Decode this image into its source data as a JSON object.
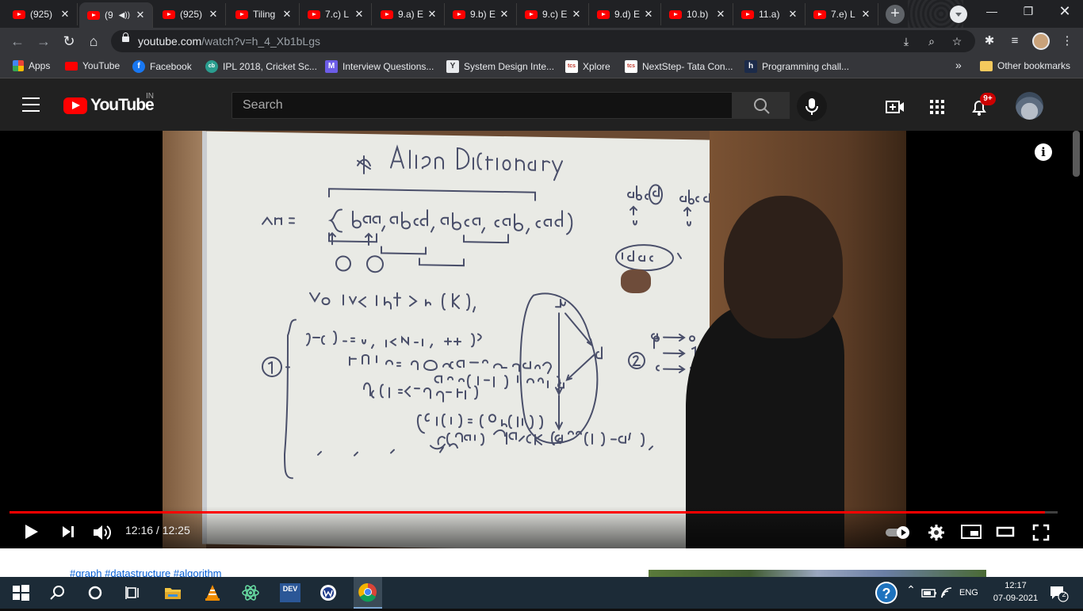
{
  "browser": {
    "tabs": [
      {
        "title": "(925)",
        "muted_icon": false
      },
      {
        "title": "(9",
        "audio": "◀))",
        "active": true
      },
      {
        "title": "(925)"
      },
      {
        "title": "Tiling"
      },
      {
        "title": "7.c) L"
      },
      {
        "title": "9.a) E"
      },
      {
        "title": "9.b) E"
      },
      {
        "title": "9.c) E"
      },
      {
        "title": "9.d) E"
      },
      {
        "title": "10.b)"
      },
      {
        "title": "11.a)"
      },
      {
        "title": "7.e) L"
      }
    ],
    "url_host": "youtube.com",
    "url_path": "/watch?v=h_4_Xb1bLgs",
    "bookmarks": [
      {
        "label": "Apps",
        "icon": "apps-grid-icon"
      },
      {
        "label": "YouTube",
        "icon": "youtube-icon"
      },
      {
        "label": "Facebook",
        "icon": "facebook-icon"
      },
      {
        "label": "IPL 2018, Cricket Sc...",
        "icon": "cricbuzz-icon"
      },
      {
        "label": "Interview Questions...",
        "icon": "interview-icon"
      },
      {
        "label": "System Design Inte...",
        "icon": "y-combinator-icon"
      },
      {
        "label": "Xplore",
        "icon": "tcs-icon"
      },
      {
        "label": "NextStep- Tata Con...",
        "icon": "tcs-icon"
      },
      {
        "label": "Programming chall...",
        "icon": "hackerrank-icon"
      }
    ],
    "more_bookmarks": "»",
    "other_bookmarks": "Other bookmarks"
  },
  "youtube": {
    "logo_text": "YouTube",
    "country_code": "IN",
    "search_placeholder": "Search",
    "notification_count": "9+"
  },
  "player": {
    "current_time": "12:16",
    "duration": "12:25",
    "time_display": "12:16 / 12:25",
    "progress_fraction": 0.988,
    "info_glyph": "i"
  },
  "below_video": {
    "hashtags": "#graph #datastructure #algorithm"
  },
  "taskbar": {
    "time": "12:17",
    "date": "07-09-2021",
    "language": "ENG",
    "notification_count": "2",
    "dev_label": "DEV"
  },
  "colors": {
    "accent_red": "#ff0000",
    "youtube_dark": "#212121",
    "chrome_dark": "#202124",
    "taskbar": "#1c2b37"
  }
}
